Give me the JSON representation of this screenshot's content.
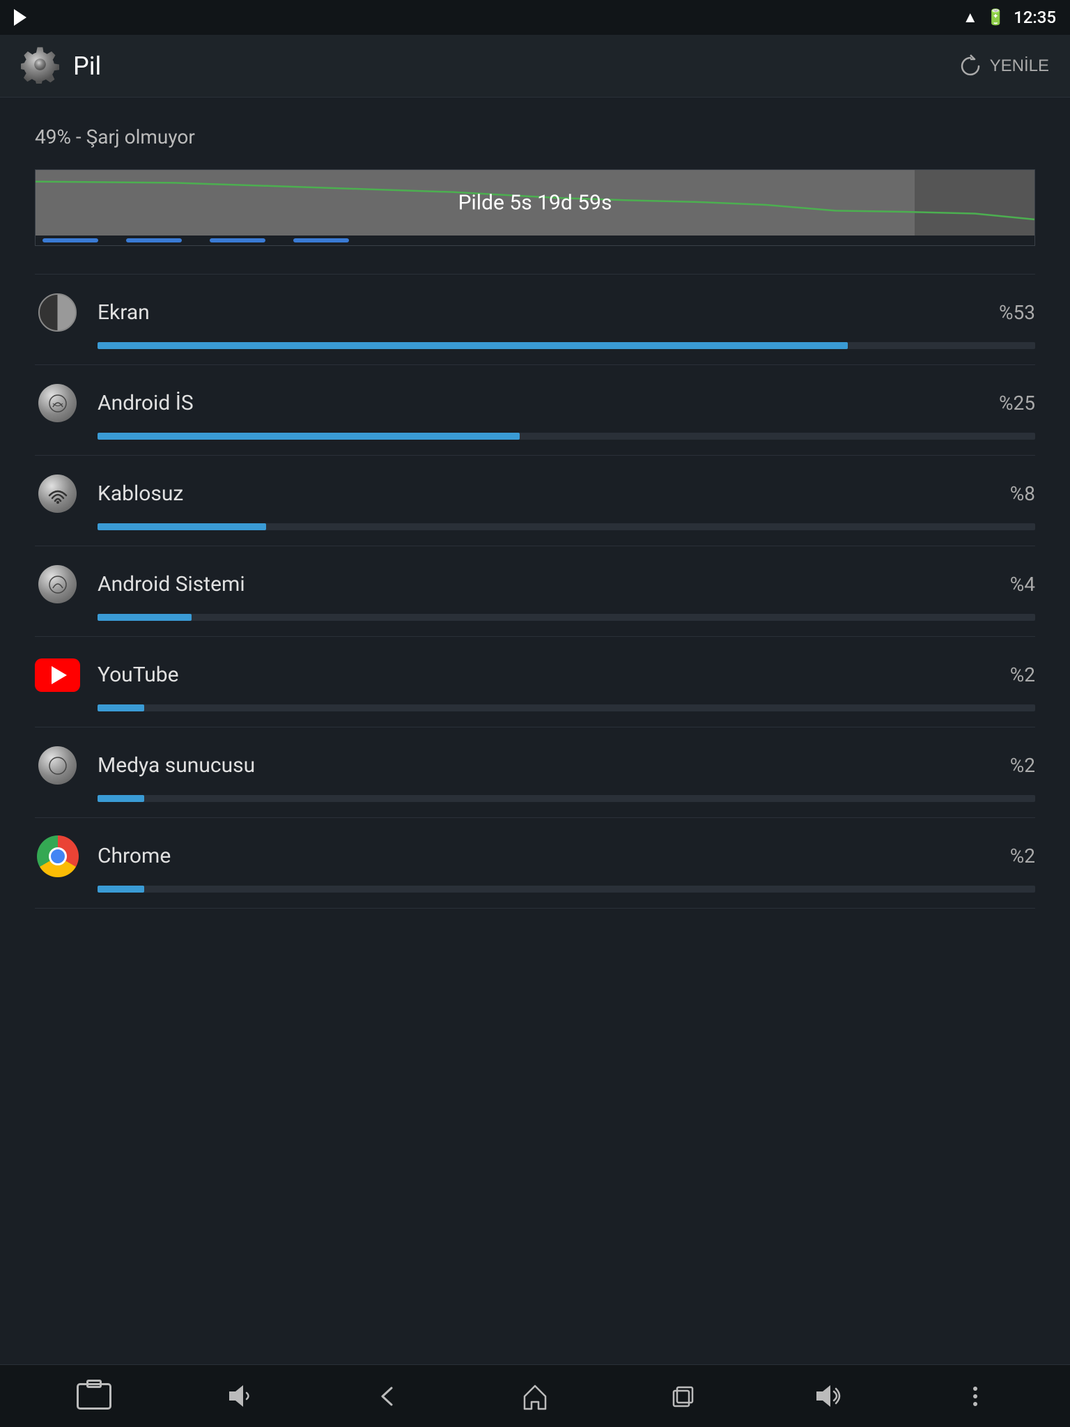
{
  "statusBar": {
    "time": "12:35"
  },
  "header": {
    "title": "Pil",
    "refreshLabel": "YENİLE"
  },
  "batteryStatus": "49% - Şarj olmuyor",
  "batteryGraph": {
    "label": "Pilde 5s 19d 59s"
  },
  "items": [
    {
      "name": "Ekran",
      "percent": "%53",
      "barWidth": "80",
      "iconType": "screen"
    },
    {
      "name": "Android İS",
      "percent": "%25",
      "barWidth": "45",
      "iconType": "android"
    },
    {
      "name": "Kablosuz",
      "percent": "%8",
      "barWidth": "18",
      "iconType": "wifi"
    },
    {
      "name": "Android Sistemi",
      "percent": "%4",
      "barWidth": "10",
      "iconType": "android"
    },
    {
      "name": "YouTube",
      "percent": "%2",
      "barWidth": "5",
      "iconType": "youtube"
    },
    {
      "name": "Medya sunucusu",
      "percent": "%2",
      "barWidth": "5",
      "iconType": "android"
    },
    {
      "name": "Chrome",
      "percent": "%2",
      "barWidth": "5",
      "iconType": "chrome"
    }
  ]
}
